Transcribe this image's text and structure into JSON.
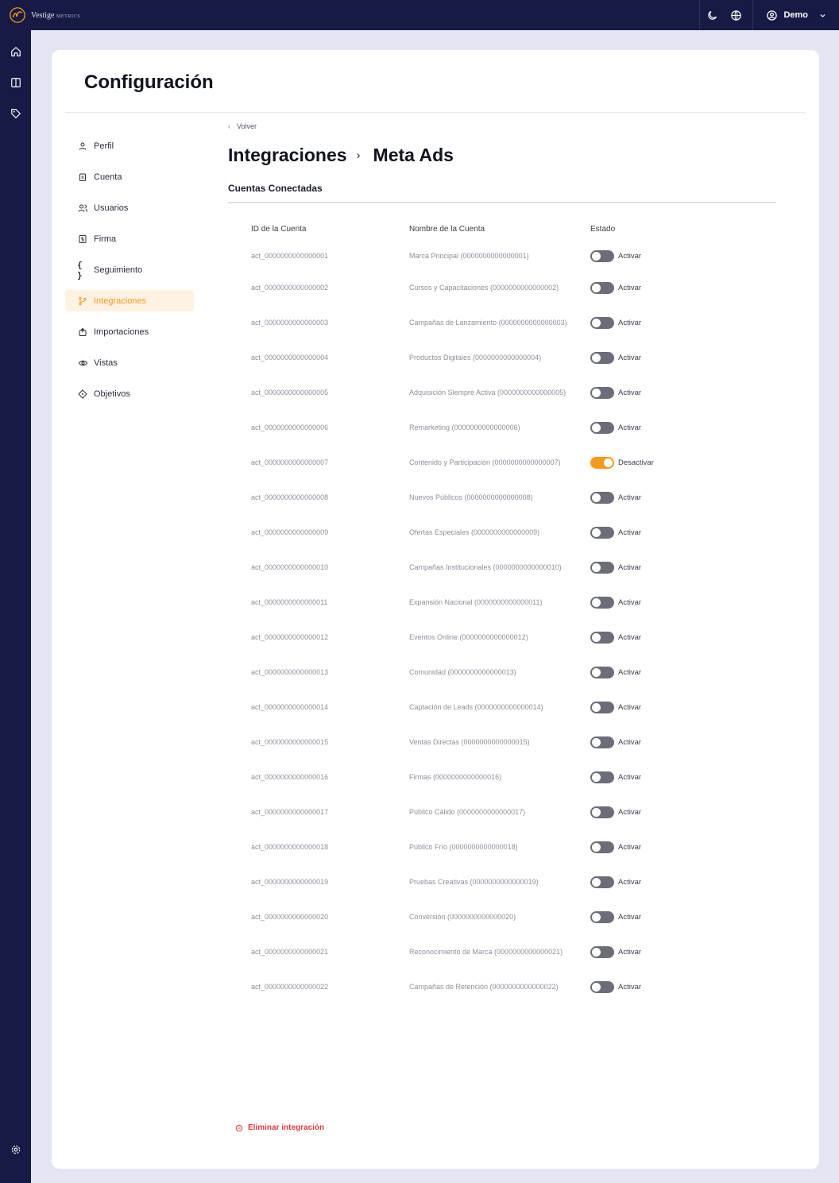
{
  "topbar": {
    "brand": "Vestige",
    "brand_sub": "METRICS",
    "user_name": "Demo",
    "icons": [
      "moon-icon",
      "globe-icon",
      "user-circle-icon",
      "chevron-down-icon"
    ]
  },
  "rail": {
    "icons": [
      "home-icon",
      "panel-icon",
      "tag-icon",
      "gear-icon"
    ]
  },
  "page": {
    "title": "Configuración"
  },
  "nav": {
    "items": [
      {
        "label": "Perfil",
        "icon": "user-icon"
      },
      {
        "label": "Cuenta",
        "icon": "clipboard-icon"
      },
      {
        "label": "Usuarios",
        "icon": "users-icon"
      },
      {
        "label": "Firma",
        "icon": "signature-icon"
      },
      {
        "label": "Seguimiento",
        "icon": "braces-icon"
      },
      {
        "label": "Integraciones",
        "icon": "branch-icon",
        "active": true
      },
      {
        "label": "Importaciones",
        "icon": "import-icon"
      },
      {
        "label": "Vistas",
        "icon": "eye-icon"
      },
      {
        "label": "Objetivos",
        "icon": "target-icon"
      }
    ]
  },
  "main": {
    "back_label": "Volver",
    "breadcrumb_parent": "Integraciones",
    "breadcrumb_sep": "›",
    "breadcrumb_current": "Meta Ads",
    "section_title": "Cuentas Conectadas",
    "columns": {
      "id": "ID de la Cuenta",
      "name": "Nombre de la Cuenta",
      "state": "Estado"
    },
    "accounts": [
      {
        "id": "act_0000000000000001",
        "name": "Marca Principal (0000000000000001)",
        "active": false,
        "action": "Activar"
      },
      {
        "id": "act_0000000000000002",
        "name": "Cursos y Capacitaciones (0000000000000002)",
        "active": false,
        "action": "Activar"
      },
      {
        "id": "act_0000000000000003",
        "name": "Campañas de Lanzamiento (0000000000000003)",
        "active": false,
        "action": "Activar"
      },
      {
        "id": "act_0000000000000004",
        "name": "Productos Digitales (0000000000000004)",
        "active": false,
        "action": "Activar"
      },
      {
        "id": "act_0000000000000005",
        "name": "Adquisición Siempre Activa (0000000000000005)",
        "active": false,
        "action": "Activar"
      },
      {
        "id": "act_0000000000000006",
        "name": "Remarketing (0000000000000006)",
        "active": false,
        "action": "Activar"
      },
      {
        "id": "act_0000000000000007",
        "name": "Contenido y Participación (0000000000000007)",
        "active": true,
        "action": "Desactivar"
      },
      {
        "id": "act_0000000000000008",
        "name": "Nuevos Públicos (0000000000000008)",
        "active": false,
        "action": "Activar"
      },
      {
        "id": "act_0000000000000009",
        "name": "Ofertas Especiales (0000000000000009)",
        "active": false,
        "action": "Activar"
      },
      {
        "id": "act_0000000000000010",
        "name": "Campañas Institucionales (0000000000000010)",
        "active": false,
        "action": "Activar"
      },
      {
        "id": "act_0000000000000011",
        "name": "Expansión Nacional (0000000000000011)",
        "active": false,
        "action": "Activar"
      },
      {
        "id": "act_0000000000000012",
        "name": "Eventos Online (0000000000000012)",
        "active": false,
        "action": "Activar"
      },
      {
        "id": "act_0000000000000013",
        "name": "Comunidad (0000000000000013)",
        "active": false,
        "action": "Activar"
      },
      {
        "id": "act_0000000000000014",
        "name": "Captación de Leads (0000000000000014)",
        "active": false,
        "action": "Activar"
      },
      {
        "id": "act_0000000000000015",
        "name": "Ventas Directas (0000000000000015)",
        "active": false,
        "action": "Activar"
      },
      {
        "id": "act_0000000000000016",
        "name": "Firmas (0000000000000016)",
        "active": false,
        "action": "Activar"
      },
      {
        "id": "act_0000000000000017",
        "name": "Público Cálido (0000000000000017)",
        "active": false,
        "action": "Activar"
      },
      {
        "id": "act_0000000000000018",
        "name": "Público Frío (0000000000000018)",
        "active": false,
        "action": "Activar"
      },
      {
        "id": "act_0000000000000019",
        "name": "Pruebas Creativas (0000000000000019)",
        "active": false,
        "action": "Activar"
      },
      {
        "id": "act_0000000000000020",
        "name": "Conversión (0000000000000020)",
        "active": false,
        "action": "Activar"
      },
      {
        "id": "act_0000000000000021",
        "name": "Reconocimiento de Marca (0000000000000021)",
        "active": false,
        "action": "Activar"
      },
      {
        "id": "act_0000000000000022",
        "name": "Campañas de Retención (0000000000000022)",
        "active": false,
        "action": "Activar"
      }
    ],
    "delete_label": "Eliminar integración"
  },
  "colors": {
    "navy": "#171a45",
    "accent": "#f39a1c",
    "danger": "#e53b3b",
    "toggle_off": "#6b6e78"
  }
}
